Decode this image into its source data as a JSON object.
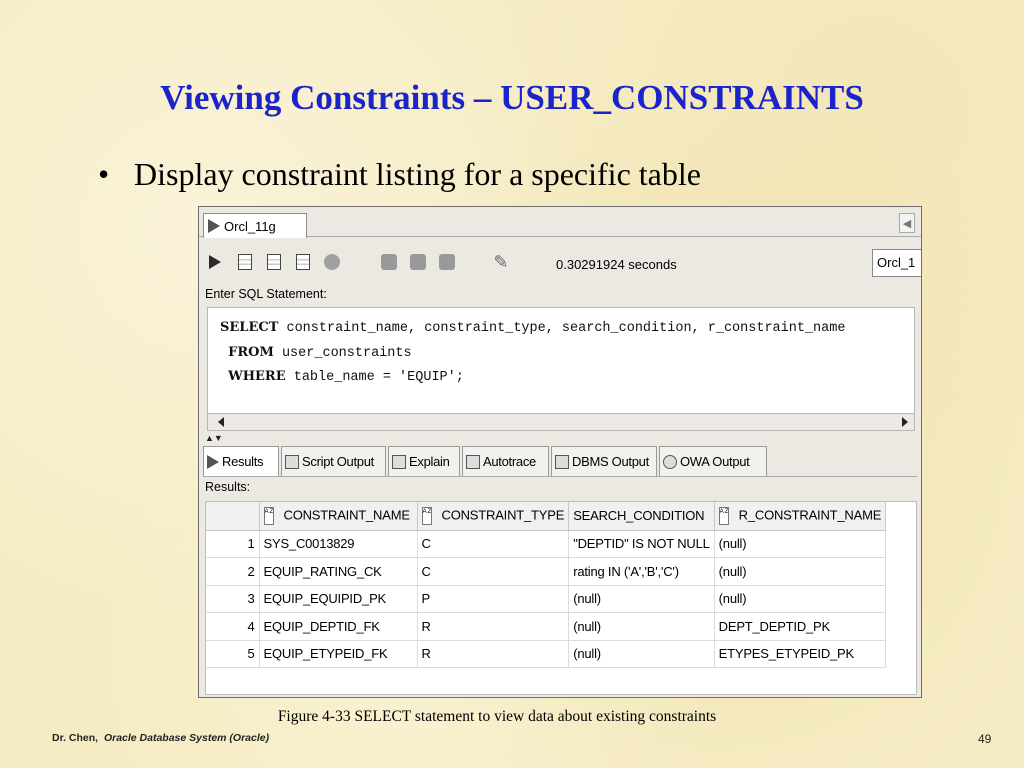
{
  "slide": {
    "title": "Viewing Constraints – USER_CONSTRAINTS",
    "bullet": "Display constraint listing for a specific table",
    "caption": "Figure 4-33    SELECT statement to view data about existing constraints",
    "footer_author": "Dr. Chen,",
    "footer_course": "Oracle Database System  (Oracle)",
    "page_number": "49"
  },
  "window": {
    "connection_tab": "Orcl_11g",
    "elapsed": "0.30291924 seconds",
    "connection_select": "Orcl_1",
    "sql_label": "Enter SQL Statement:",
    "sql": {
      "line1_kw": "SELECT",
      "line1_rest": " constraint_name, constraint_type, search_condition, r_constraint_name",
      "line2_kw": "FROM",
      "line2_rest": " user_constraints",
      "line3_kw": "WHERE",
      "line3_rest": " table_name = 'EQUIP';"
    },
    "tabs": [
      "Results",
      "Script Output",
      "Explain",
      "Autotrace",
      "DBMS Output",
      "OWA Output"
    ],
    "results_label": "Results:",
    "columns": [
      "CONSTRAINT_NAME",
      "CONSTRAINT_TYPE",
      "SEARCH_CONDITION",
      "R_CONSTRAINT_NAME"
    ],
    "rows": [
      [
        "1",
        "SYS_C0013829",
        "C",
        "\"DEPTID\" IS NOT NULL",
        "(null)"
      ],
      [
        "2",
        "EQUIP_RATING_CK",
        "C",
        "rating IN ('A','B','C')",
        "(null)"
      ],
      [
        "3",
        "EQUIP_EQUIPID_PK",
        "P",
        "(null)",
        "(null)"
      ],
      [
        "4",
        "EQUIP_DEPTID_FK",
        "R",
        "(null)",
        "DEPT_DEPTID_PK"
      ],
      [
        "5",
        "EQUIP_ETYPEID_FK",
        "R",
        "(null)",
        "ETYPES_ETYPEID_PK"
      ]
    ]
  },
  "colors": {
    "title": "#1a24c8",
    "background": "#f6ecc4"
  }
}
